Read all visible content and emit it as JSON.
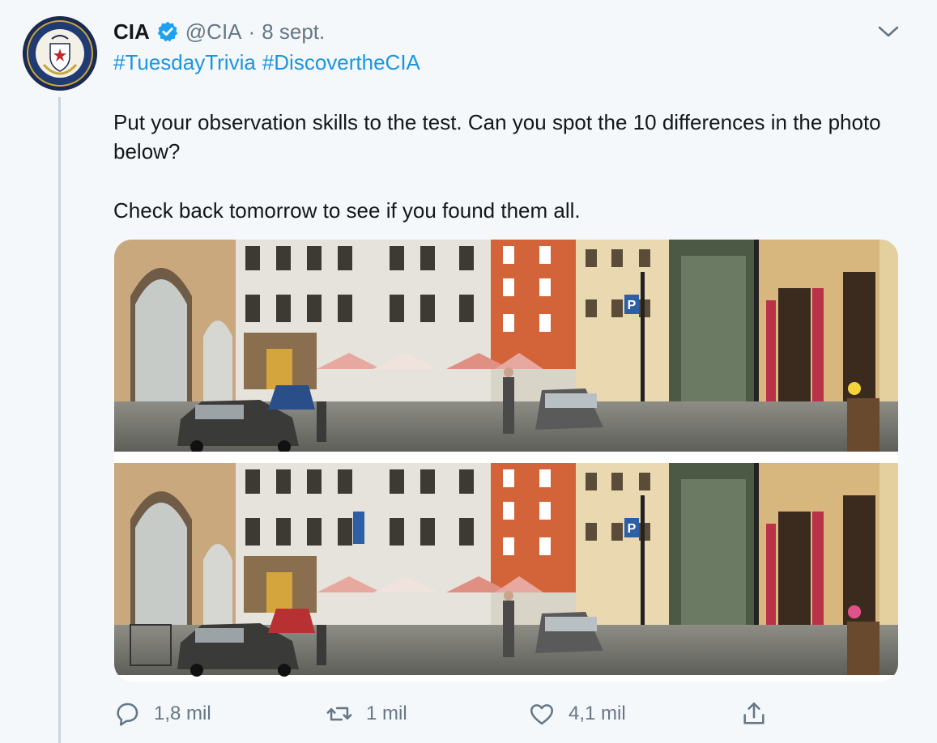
{
  "tweet": {
    "author_name": "CIA",
    "handle": "@CIA",
    "separator": "·",
    "date": "8 sept.",
    "hashtags": [
      "#TuesdayTrivia",
      "#DiscovertheCIA"
    ],
    "text_line1": "Put your observation skills to the test. Can you spot the 10 differences in the photo below?",
    "text_line2": "Check back tomorrow to see if you found them all.",
    "media": {
      "description_icon": "spot-the-difference-street-photo"
    },
    "actions": {
      "replies": "1,8 mil",
      "retweets": "1 mil",
      "likes": "4,1 mil"
    }
  },
  "icons": {
    "verified": "verified-badge-icon",
    "menu": "chevron-down-icon",
    "reply": "reply-icon",
    "retweet": "retweet-icon",
    "like": "heart-icon",
    "share": "share-icon"
  },
  "colors": {
    "link": "#1b95e0",
    "muted": "#657786",
    "background": "#f5f8fa",
    "verified": "#1da1f2"
  }
}
